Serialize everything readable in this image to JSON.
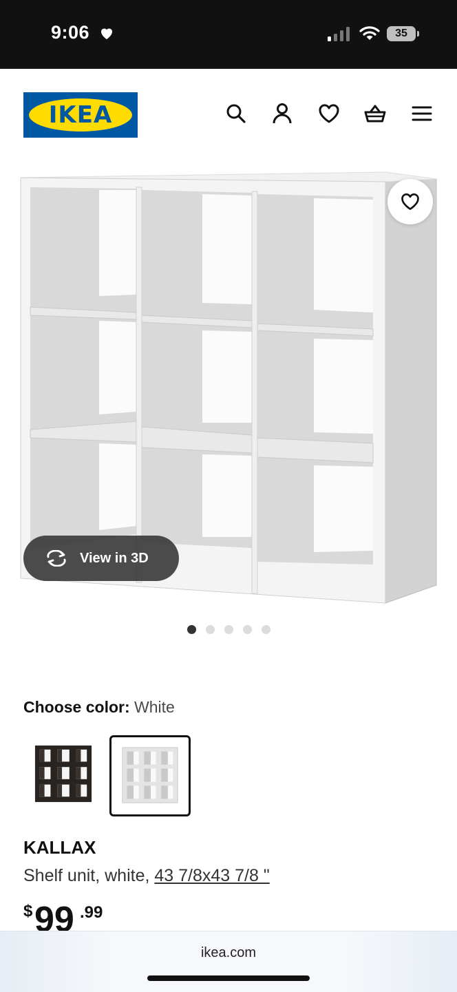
{
  "status_bar": {
    "time": "9:06",
    "battery": "35",
    "icons": [
      "heart-icon",
      "signal-icon",
      "wifi-icon",
      "battery-icon"
    ]
  },
  "header": {
    "logo_text": "IKEA",
    "icons": [
      "search-icon",
      "account-icon",
      "wishlist-icon",
      "cart-icon",
      "menu-icon"
    ]
  },
  "gallery": {
    "view_3d_label": "View in 3D",
    "image_count": 5,
    "active_image": 1
  },
  "color_picker": {
    "label": "Choose color:",
    "selected": "White",
    "swatches": [
      {
        "color": "#2a2420",
        "selected": false
      },
      {
        "color": "#f2f2f2",
        "selected": true
      }
    ]
  },
  "product": {
    "name": "KALLAX",
    "description": "Shelf unit, white,",
    "dimensions": "43 7/8x43 7/8 \"",
    "price_currency": "$",
    "price_whole": "99",
    "price_decimal": ".99"
  },
  "browser": {
    "url": "ikea.com"
  },
  "colors": {
    "ikea_blue": "#0058a3",
    "ikea_yellow": "#ffdb00"
  }
}
